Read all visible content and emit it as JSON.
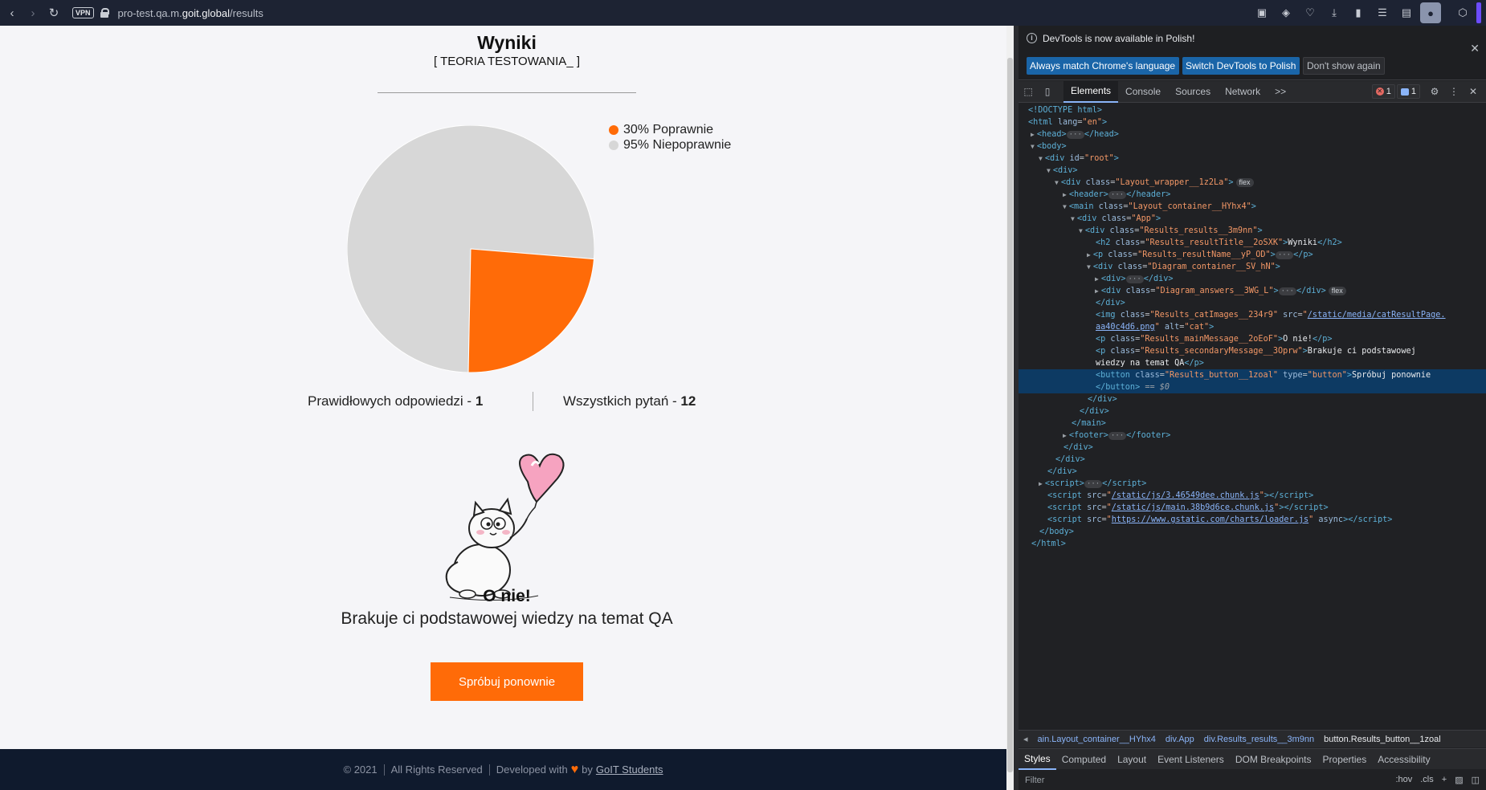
{
  "browser": {
    "url_prefix": "pro-test.qa.m.",
    "url_domain": "goit.global",
    "url_path": "/results",
    "vpn_label": "VPN"
  },
  "page": {
    "title": "Wyniki",
    "subtitle": "[ TEORIA TESTOWANIA_ ]",
    "legend": [
      {
        "label": "30% Poprawnie",
        "color": "#ff6b08"
      },
      {
        "label": "95% Niepoprawnie",
        "color": "#d7d7d7"
      }
    ],
    "stats": {
      "correct_label": "Prawidłowych odpowiedzi - ",
      "correct_value": "1",
      "total_label": "Wszystkich pytań - ",
      "total_value": "12"
    },
    "main_message": "O nie!",
    "secondary_message": "Brakuje ci podstawowej wiedzy na temat QA",
    "retry_label": "Spróbuj ponownie",
    "footer": {
      "copyright": "© 2021",
      "rights": "All Rights Reserved",
      "developed": "Developed with",
      "by": "by",
      "link": "GoIT Students"
    }
  },
  "chart_data": {
    "type": "pie",
    "categories": [
      "Poprawnie",
      "Niepoprawnie"
    ],
    "values": [
      30,
      95
    ],
    "colors": [
      "#ff6b08",
      "#d7d7d7"
    ],
    "legend_position": "top-right"
  },
  "devtools": {
    "info_text": "DevTools is now available in Polish!",
    "btn_match": "Always match Chrome's language",
    "btn_switch": "Switch DevTools to Polish",
    "btn_dismiss": "Don't show again",
    "tabs": [
      "Elements",
      "Console",
      "Sources",
      "Network"
    ],
    "more_tabs": ">>",
    "error_count": "1",
    "message_count": "1",
    "breadcrumbs": [
      "ain.Layout_container__HYhx4",
      "div.App",
      "div.Results_results__3m9nn",
      "button.Results_button__1zoal"
    ],
    "sub_tabs": [
      "Styles",
      "Computed",
      "Layout",
      "Event Listeners",
      "DOM Breakpoints",
      "Properties",
      "Accessibility"
    ],
    "filter_placeholder": "Filter",
    "filter_hov": ":hov",
    "filter_cls": ".cls",
    "dom": {
      "doctype": "<!DOCTYPE html>",
      "html_open": "<html",
      "lang_attr": "lang",
      "lang_val": "\"en\"",
      "head": "<head>",
      "head_close": "</head>",
      "body": "<body>",
      "root_div": "<div",
      "id_attr": "id",
      "id_val": "\"root\"",
      "div": "<div>",
      "layout_wrapper": "\"Layout_wrapper__1z2La\"",
      "header": "<header>",
      "header_close": "</header>",
      "main": "<main",
      "layout_container": "\"Layout_container__HYhx4\"",
      "app": "\"App\"",
      "results": "\"Results_results__3m9nn\"",
      "h2_class": "\"Results_resultTitle__2oSXK\"",
      "h2_text": "Wyniki",
      "p_name": "\"Results_resultName__yP_OD\"",
      "diagram_container": "\"Diagram_container__SV_hN\"",
      "diagram_answers": "\"Diagram_answers__3WG_L\"",
      "img_class": "\"Results_catImages__234r9\"",
      "img_src": "/static/media/catResultPage.",
      "img_src2": "aa40c4d6.png",
      "img_alt": "\"cat\"",
      "main_msg_class": "\"Results_mainMessage__2oEoF\"",
      "main_msg_text": "O nie!",
      "second_msg_class": "\"Results_secondaryMessage__3Oprw\"",
      "second_msg_text1": "Brakuje ci podstawowej",
      "second_msg_text2": "wiedzy na temat QA",
      "button_class": "\"Results_button__1zoal\"",
      "button_type": "\"button\"",
      "button_text": "Spróbuj ponownie",
      "button_close": "</button>",
      "eq": "== $0",
      "footer": "<footer>",
      "footer_close": "</footer>",
      "script1": "/static/js/3.46549dee.chunk.js",
      "script2": "/static/js/main.38b9d6ce.chunk.js",
      "script3": "https://www.gstatic.com/charts/loader.js",
      "async": "async",
      "flex": "flex"
    }
  }
}
